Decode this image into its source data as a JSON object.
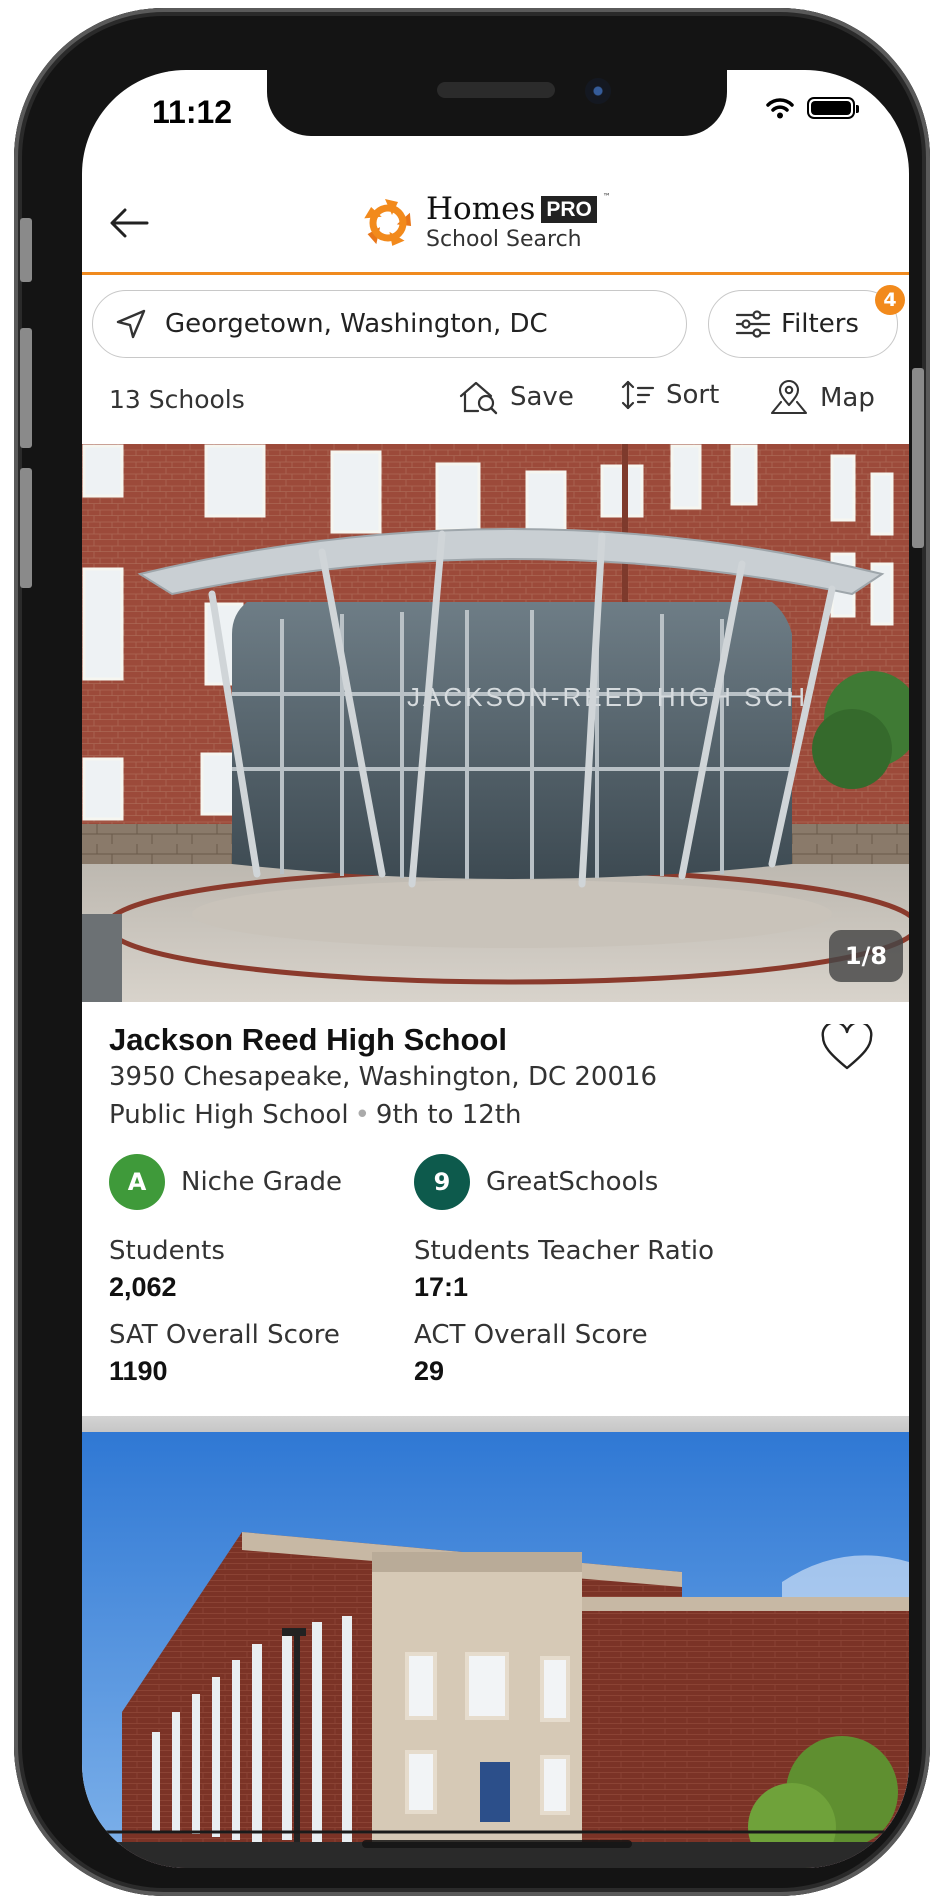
{
  "status_bar": {
    "time": "11:12"
  },
  "header": {
    "brand": "Homes",
    "brand_badge": "PRO",
    "trademark": "™",
    "subtitle": "School Search",
    "accent_color": "#f08a1e"
  },
  "search": {
    "location": "Georgetown, Washington, DC"
  },
  "filters": {
    "label": "Filters",
    "count": "4"
  },
  "toolbar": {
    "results_count": "13 Schools",
    "save_label": "Save",
    "sort_label": "Sort",
    "map_label": "Map"
  },
  "schools": [
    {
      "photo_counter": "1/8",
      "name": "Jackson Reed High School",
      "address": "3950 Chesapeake, Washington, DC 20016",
      "type": "Public High School",
      "separator": "•",
      "grades": "9th to 12th",
      "niche_grade": "A",
      "niche_label": "Niche Grade",
      "niche_color": "#3f9a3a",
      "greatschools_score": "9",
      "greatschools_label": "GreatSchools",
      "greatschools_color": "#0d5a4c",
      "building_sign": "JACKSON-REED HIGH SCH",
      "stats": [
        {
          "label": "Students",
          "value": "2,062"
        },
        {
          "label": "Students Teacher Ratio",
          "value": "17:1"
        },
        {
          "label": "SAT Overall Score",
          "value": "1190"
        },
        {
          "label": "ACT Overall Score",
          "value": "29"
        }
      ]
    }
  ],
  "icons": [
    "back-arrow-icon",
    "homes-logo-icon",
    "location-arrow-icon",
    "sliders-icon",
    "save-search-icon",
    "sort-icon",
    "map-pin-icon",
    "heart-icon",
    "wifi-icon",
    "battery-icon"
  ]
}
